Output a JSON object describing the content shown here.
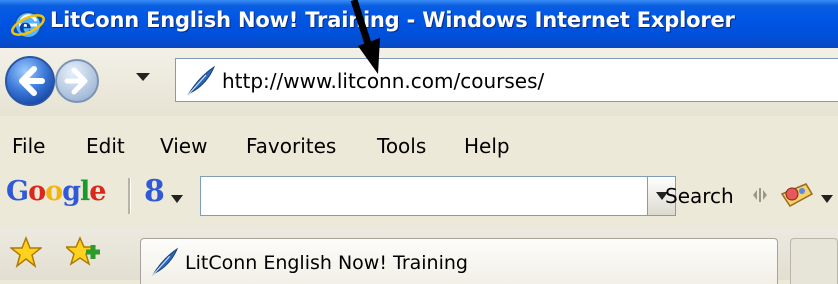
{
  "window": {
    "title": "LitConn English Now! Training - Windows Internet Explorer",
    "icon": "ie-logo"
  },
  "navigation": {
    "back_icon": "back-arrow-icon",
    "forward_icon": "forward-arrow-icon",
    "address_url": "http://www.litconn.com/courses/",
    "site_icon": "feather-icon"
  },
  "menu": {
    "items": [
      "File",
      "Edit",
      "View",
      "Favorites",
      "Tools",
      "Help"
    ]
  },
  "google_toolbar": {
    "logo_letters": [
      "G",
      "o",
      "o",
      "g",
      "l",
      "e"
    ],
    "logo_colors": [
      "#2f59d8",
      "#d9281e",
      "#f2b50f",
      "#2f59d8",
      "#1a9a2a",
      "#d9281e"
    ],
    "button_glyph": "8",
    "search_value": "",
    "search_label": "Search"
  },
  "tabs": [
    {
      "title": "LitConn English Now! Training",
      "icon": "feather-icon"
    }
  ],
  "colors": {
    "titlebar": "#0055e5",
    "chrome": "#ece9d8",
    "address_border": "#7f9db9"
  }
}
